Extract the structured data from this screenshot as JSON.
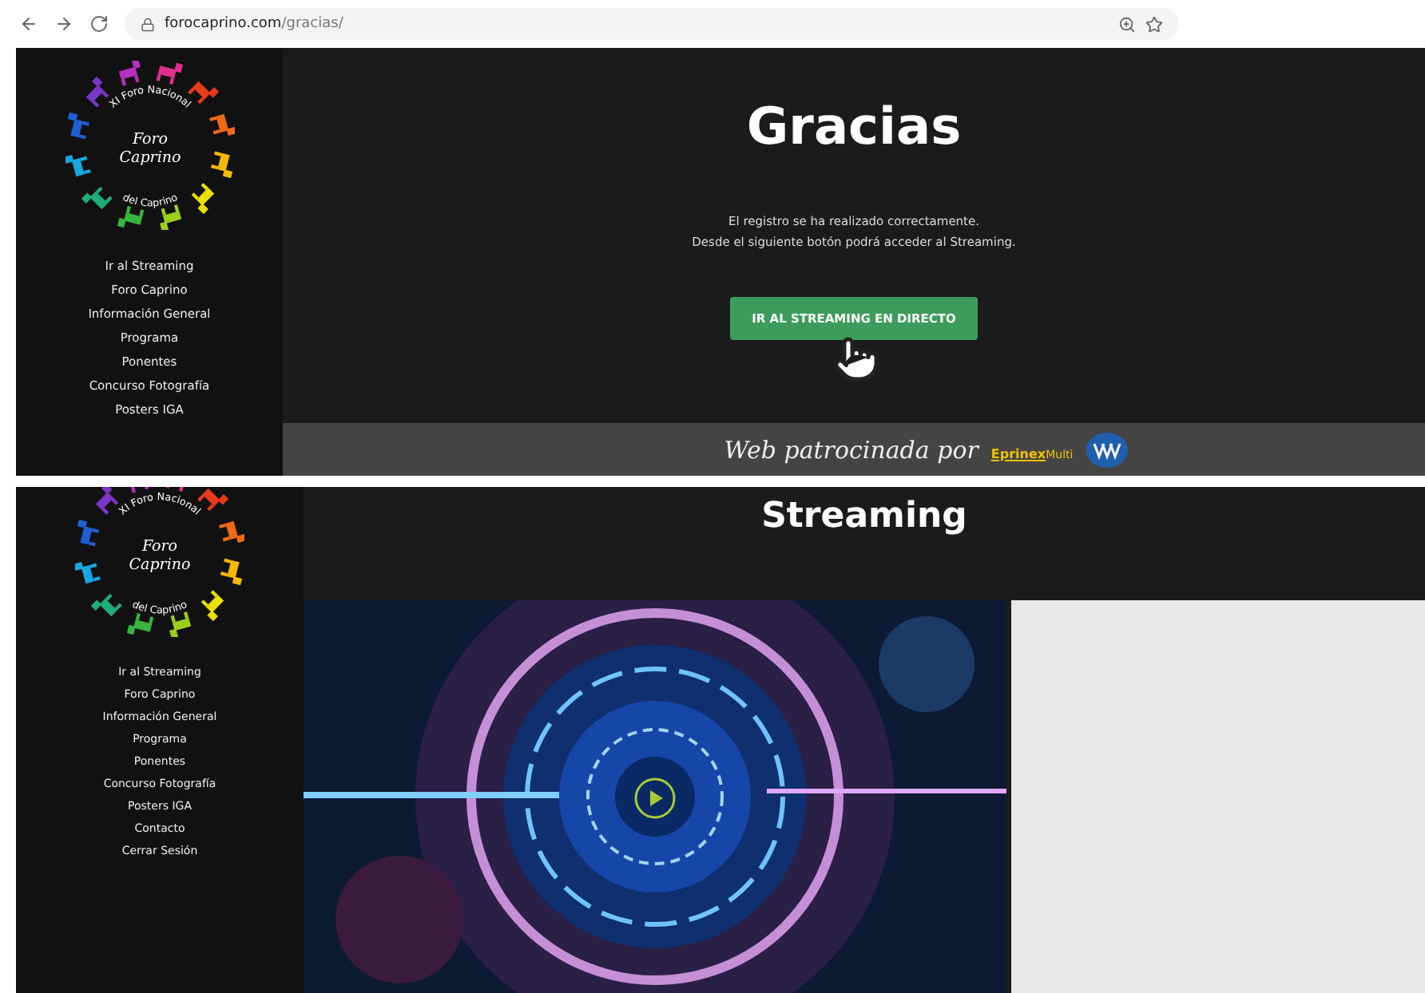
{
  "browser": {
    "url_host": "forocaprino.com",
    "url_path": "/gracias/"
  },
  "gracias_page": {
    "logo": {
      "ring_text": "XI Foro Nacional del Caprino",
      "title_top": "Foro",
      "title_bottom": "Caprino"
    },
    "nav": [
      "Ir al Streaming",
      "Foro Caprino",
      "Información General",
      "Programa",
      "Ponentes",
      "Concurso Fotografía",
      "Posters IGA"
    ],
    "title": "Gracias",
    "message": [
      "El registro se ha realizado correctamente.",
      "Desde el siguiente botón podrá acceder al Streaming."
    ],
    "button": "IR AL STREAMING EN DIRECTO",
    "sponsor": {
      "text": "Web patrocinada por",
      "brand": "Eprinex",
      "brand_suffix": "Multi"
    }
  },
  "streaming_page": {
    "logo": {
      "ring_text": "XI Foro Nacional del Caprino",
      "title_top": "Foro",
      "title_bottom": "Caprino"
    },
    "nav": [
      "Ir al Streaming",
      "Foro Caprino",
      "Información General",
      "Programa",
      "Ponentes",
      "Concurso Fotografía",
      "Posters IGA",
      "Contacto",
      "Cerrar Sesión"
    ],
    "title": "Streaming"
  }
}
